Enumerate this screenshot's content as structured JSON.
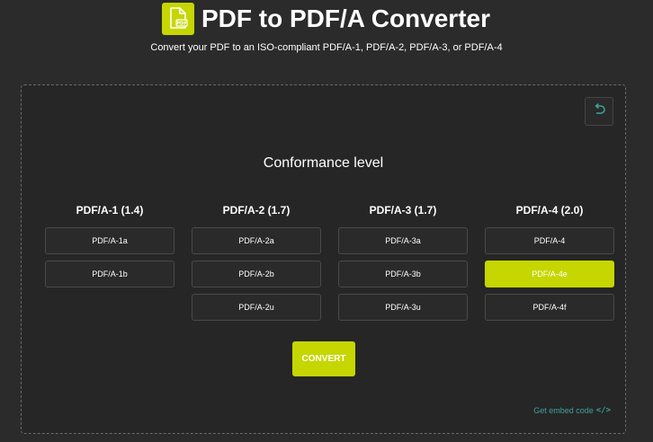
{
  "header": {
    "logo_icon": "pdf-file-icon",
    "title": "PDF to PDF/A Converter",
    "subtitle": "Convert your PDF to an ISO-compliant PDF/A-1, PDF/A-2, PDF/A-3, or PDF/A-4"
  },
  "panel": {
    "reset_icon": "undo-icon",
    "heading": "Conformance level",
    "columns": [
      {
        "heading": "PDF/A-1 (1.4)",
        "options": [
          "PDF/A-1a",
          "PDF/A-1b"
        ]
      },
      {
        "heading": "PDF/A-2 (1.7)",
        "options": [
          "PDF/A-2a",
          "PDF/A-2b",
          "PDF/A-2u"
        ]
      },
      {
        "heading": "PDF/A-3 (1.7)",
        "options": [
          "PDF/A-3a",
          "PDF/A-3b",
          "PDF/A-3u"
        ]
      },
      {
        "heading": "PDF/A-4 (2.0)",
        "options": [
          "PDF/A-4",
          "PDF/A-4e",
          "PDF/A-4f"
        ]
      }
    ],
    "selected": "PDF/A-4e",
    "convert_label": "CONVERT",
    "embed_label": "Get embed code",
    "embed_icon": "code-icon"
  },
  "colors": {
    "accent": "#c5d600",
    "background": "#2b2b2b",
    "link": "#3fa29a"
  }
}
